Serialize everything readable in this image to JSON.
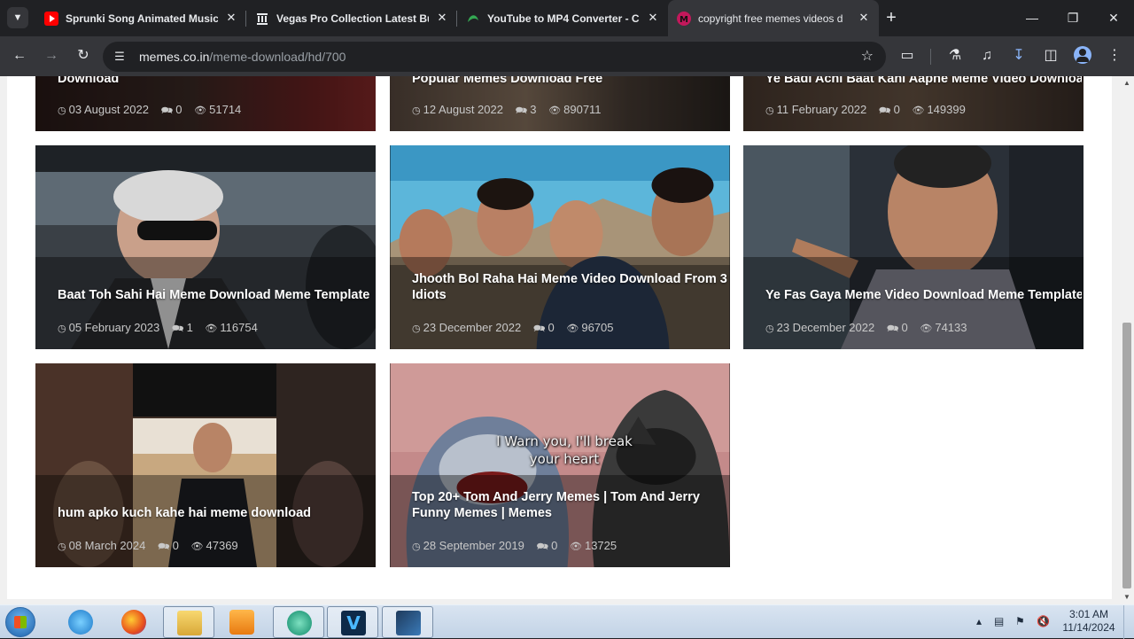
{
  "tabs": [
    {
      "title": "Sprunki Song Animated Music",
      "favicon": "youtube-icon",
      "color": "#ff0000"
    },
    {
      "title": "Vegas Pro Collection Latest Bu",
      "favicon": "bank-icon",
      "color": "#e8eaed"
    },
    {
      "title": "YouTube to MP4 Converter - C",
      "favicon": "swirl-icon",
      "color": "#34a853"
    },
    {
      "title": "copyright free memes videos d",
      "favicon": "memes-m-icon",
      "color": "#c2185b"
    }
  ],
  "omnibox": {
    "host": "memes.co.in",
    "path": "/meme-download/hd/700"
  },
  "cards": [
    {
      "title": "Download",
      "date": "03 August 2022",
      "comments": "0",
      "views": "51714"
    },
    {
      "title": "Popular Memes Download Free",
      "date": "12 August 2022",
      "comments": "3",
      "views": "890711"
    },
    {
      "title": "Ye Badi Achi Baat Kahi Aapne Meme Video Download",
      "date": "11 February 2022",
      "comments": "0",
      "views": "149399"
    },
    {
      "title": "Baat Toh Sahi Hai Meme Download Meme Template",
      "date": "05 February 2023",
      "comments": "1",
      "views": "116754"
    },
    {
      "title": "Jhooth Bol Raha Hai Meme Video Download From 3 Idiots",
      "date": "23 December 2022",
      "comments": "0",
      "views": "96705"
    },
    {
      "title": "Ye Fas Gaya Meme Video Download Meme Template",
      "date": "23 December 2022",
      "comments": "0",
      "views": "74133"
    },
    {
      "title": "hum apko kuch kahe hai meme download",
      "date": "08 March 2024",
      "comments": "0",
      "views": "47369"
    },
    {
      "title": "Top 20+ Tom And Jerry Memes | Tom And Jerry Funny Memes | Memes",
      "date": "28 September 2019",
      "comments": "0",
      "views": "13725",
      "caption": "I Warn you, I'll break your heart"
    }
  ],
  "clock": {
    "time": "3:01 AM",
    "date": "11/14/2024"
  },
  "colors": {
    "tab_bg": "#202124",
    "toolbar_bg": "#35363a",
    "accent": "#8ab4f8",
    "download_icon": "#8ab4f8"
  }
}
